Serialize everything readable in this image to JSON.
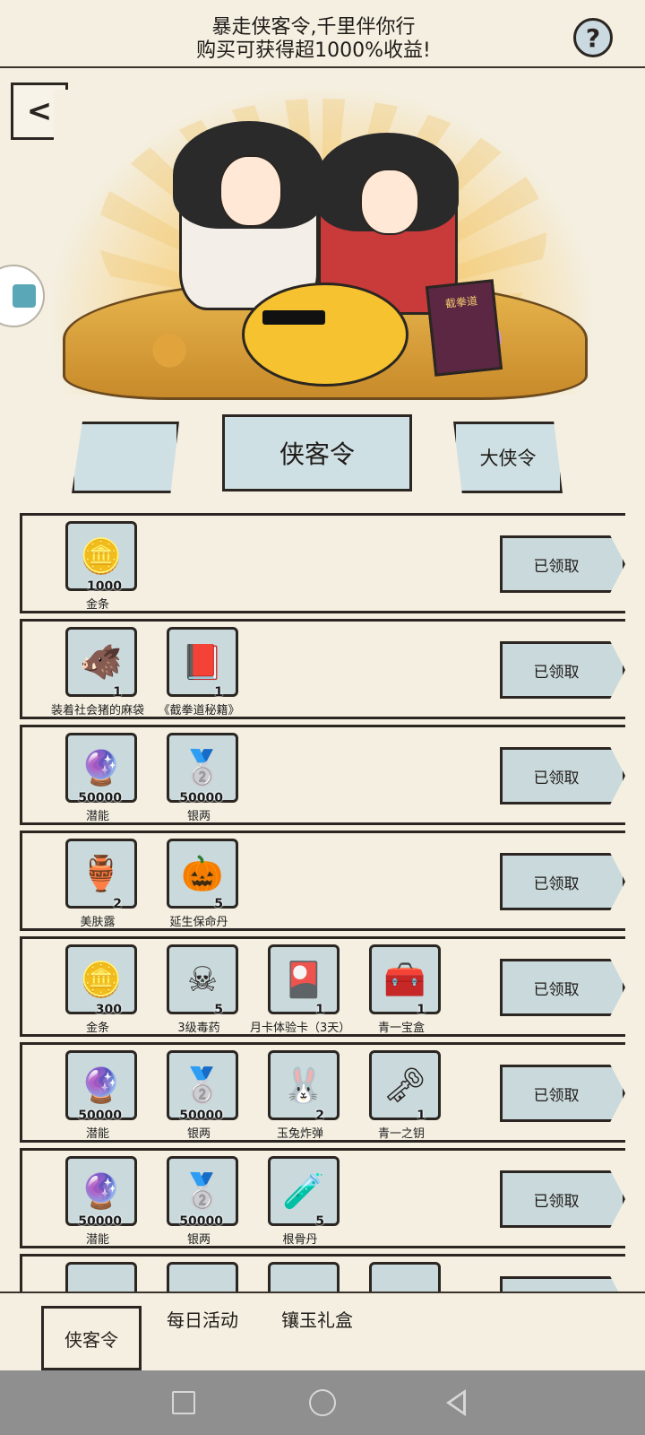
{
  "header": {
    "line1": "暴走侠客令,千里伴你行",
    "line2": "购买可获得超1000%收益!",
    "help_label": "?"
  },
  "back_label": "<",
  "tabs": {
    "left": "",
    "middle": "侠客令",
    "right": "大侠令"
  },
  "claimed_label": "已领取",
  "rows": [
    {
      "items": [
        {
          "icon": "gold-bar-icon",
          "glyph": "🪙",
          "count": "1000",
          "name": "金条"
        }
      ]
    },
    {
      "items": [
        {
          "icon": "sack-pig-icon",
          "glyph": "🐗",
          "count": "1",
          "name": "装着社会猪的麻袋"
        },
        {
          "icon": "book-icon",
          "glyph": "📕",
          "count": "1",
          "name": "《截拳道秘籍》"
        }
      ]
    },
    {
      "items": [
        {
          "icon": "potential-orbs-icon",
          "glyph": "🔮",
          "count": "50000",
          "name": "潜能"
        },
        {
          "icon": "silver-ingot-icon",
          "glyph": "🥈",
          "count": "50000",
          "name": "银两"
        }
      ]
    },
    {
      "items": [
        {
          "icon": "vase-icon",
          "glyph": "🏺",
          "count": "2",
          "name": "美肤露"
        },
        {
          "icon": "pill-gourd-icon",
          "glyph": "🎃",
          "count": "5",
          "name": "延生保命丹"
        }
      ]
    },
    {
      "items": [
        {
          "icon": "gold-bar-icon",
          "glyph": "🪙",
          "count": "300",
          "name": "金条"
        },
        {
          "icon": "poison-hat-icon",
          "glyph": "☠",
          "count": "5",
          "name": "3级毒药"
        },
        {
          "icon": "month-card-icon",
          "glyph": "🎴",
          "count": "1",
          "name": "月卡体验卡（3天）"
        },
        {
          "icon": "treasure-chest-icon",
          "glyph": "🧰",
          "count": "1",
          "name": "青一宝盒"
        }
      ]
    },
    {
      "items": [
        {
          "icon": "potential-orbs-icon",
          "glyph": "🔮",
          "count": "50000",
          "name": "潜能"
        },
        {
          "icon": "silver-ingot-icon",
          "glyph": "🥈",
          "count": "50000",
          "name": "银两"
        },
        {
          "icon": "rabbit-bomb-icon",
          "glyph": "🐰",
          "count": "2",
          "name": "玉兔炸弹"
        },
        {
          "icon": "key-icon",
          "glyph": "🗝",
          "count": "1",
          "name": "青一之钥"
        }
      ]
    },
    {
      "items": [
        {
          "icon": "potential-orbs-icon",
          "glyph": "🔮",
          "count": "50000",
          "name": "潜能"
        },
        {
          "icon": "silver-ingot-icon",
          "glyph": "🥈",
          "count": "50000",
          "name": "银两"
        },
        {
          "icon": "bottle-icon",
          "glyph": "🧪",
          "count": "5",
          "name": "根骨丹"
        }
      ]
    },
    {
      "items": [
        {
          "icon": "item-icon",
          "glyph": "",
          "count": "",
          "name": ""
        },
        {
          "icon": "item-icon",
          "glyph": "",
          "count": "",
          "name": ""
        },
        {
          "icon": "item-icon",
          "glyph": "",
          "count": "",
          "name": ""
        },
        {
          "icon": "item-icon",
          "glyph": "",
          "count": "",
          "name": ""
        }
      ]
    }
  ],
  "bottom_tabs": [
    "侠客令",
    "每日活动",
    "镶玉礼盒"
  ],
  "colors": {
    "background": "#f4efe1",
    "panel": "#c9d9dc",
    "ink": "#2b2621",
    "nav_bar": "#8f8f8f"
  }
}
